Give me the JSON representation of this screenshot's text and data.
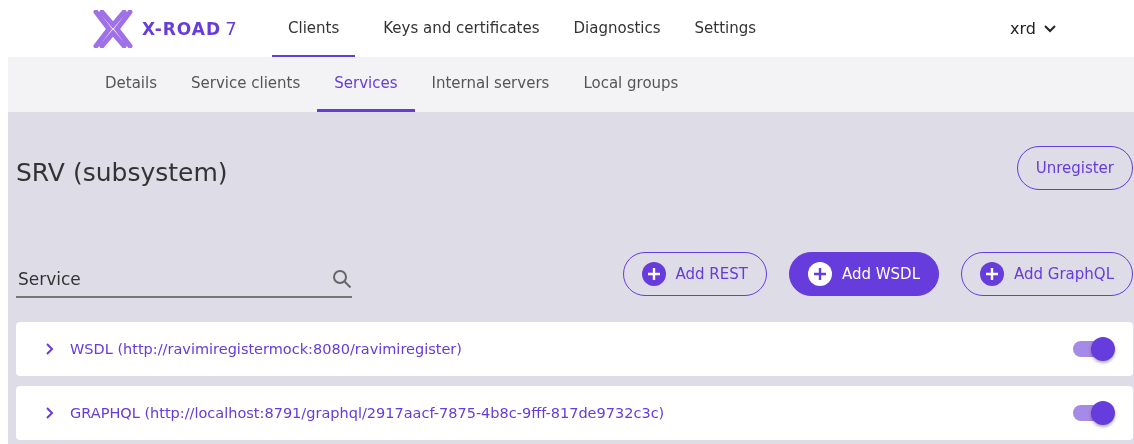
{
  "logo": {
    "name": "X-ROAD",
    "version": "7"
  },
  "main_tabs": [
    {
      "label": "Clients",
      "selected": true
    },
    {
      "label": "Keys and certificates",
      "selected": false
    },
    {
      "label": "Diagnostics",
      "selected": false
    },
    {
      "label": "Settings",
      "selected": false
    }
  ],
  "user": {
    "name": "xrd"
  },
  "sub_tabs": [
    {
      "label": "Details",
      "selected": false
    },
    {
      "label": "Service clients",
      "selected": false
    },
    {
      "label": "Services",
      "selected": true
    },
    {
      "label": "Internal servers",
      "selected": false
    },
    {
      "label": "Local groups",
      "selected": false
    }
  ],
  "title": "SRV (subsystem)",
  "unregister_button": "Unregister",
  "search": {
    "placeholder": "Service"
  },
  "add_buttons": [
    {
      "label": "Add REST",
      "kind": "outlined"
    },
    {
      "label": "Add WSDL",
      "kind": "filled"
    },
    {
      "label": "Add GraphQL",
      "kind": "outlined"
    }
  ],
  "services": [
    {
      "label": "WSDL (http://ravimiregistermock:8080/ravimiregister)",
      "expanded": false,
      "on": true
    },
    {
      "label": "GRAPHQL (http://localhost:8791/graphql/2917aacf-7875-4b8c-9fff-817de9732c3c)",
      "expanded": false,
      "on": true
    }
  ]
}
